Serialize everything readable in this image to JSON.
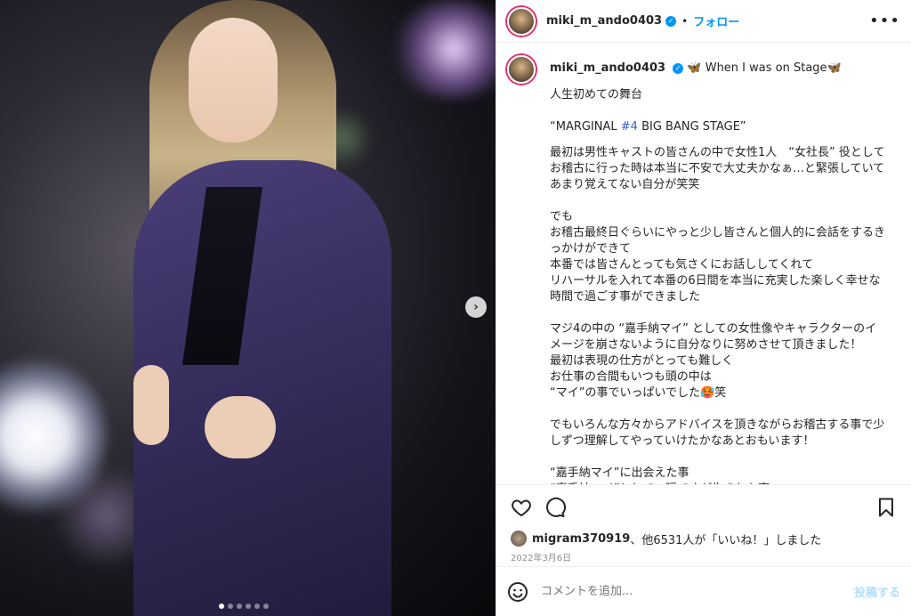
{
  "post": {
    "username": "miki_m_ando0403",
    "separator": "•",
    "follow_label": "フォロー",
    "more_label": "•••",
    "caption_title": "🦋 When I was on Stage🦋",
    "caption_lines": [
      "人生初めての舞台",
      "",
      "“MARGINAL ",
      "#4",
      " BIG BANG STAGE”"
    ],
    "caption_text": "最初は男性キャストの皆さんの中で女性1人　“女社長” 役としてお稽古に行った時は本当に不安で大丈夫かなぁ…と緊張していてあまり覚えてない自分が笑笑\n\nでも\nお稽古最終日ぐらいにやっと少し皆さんと個人的に会話をするきっかけができて\n本番では皆さんとっても気さくにお話ししてくれて\nリハーサルを入れて本番の6日間を本当に充実した楽しく幸せな時間で過ごす事ができました\n\nマジ4の中の “嘉手納マイ” としての女性像やキャラクターのイメージを崩さないように自分なりに努めさせて頂きました！\n最初は表現の仕方がとっても難しく\nお仕事の合間もいつも頭の中は\n“マイ”の事でいっぱいでした🥵笑\n\nでもいろんな方々からアドバイスを頂きながらお稽古する事で少しずつ理解してやっていけたかなあとおもいます！\n\n“嘉手納マイ”に出会えた事\n“嘉手納マイ”として一瞬ですが生きれた事",
    "likes_user": "migram370919",
    "likes_rest": "、他6531人が「いいね！」しました",
    "date": "2022年3月6日",
    "comment_placeholder": "コメントを追加...",
    "post_label": "投稿する",
    "carousel": {
      "count": 6,
      "active_index": 0
    }
  }
}
